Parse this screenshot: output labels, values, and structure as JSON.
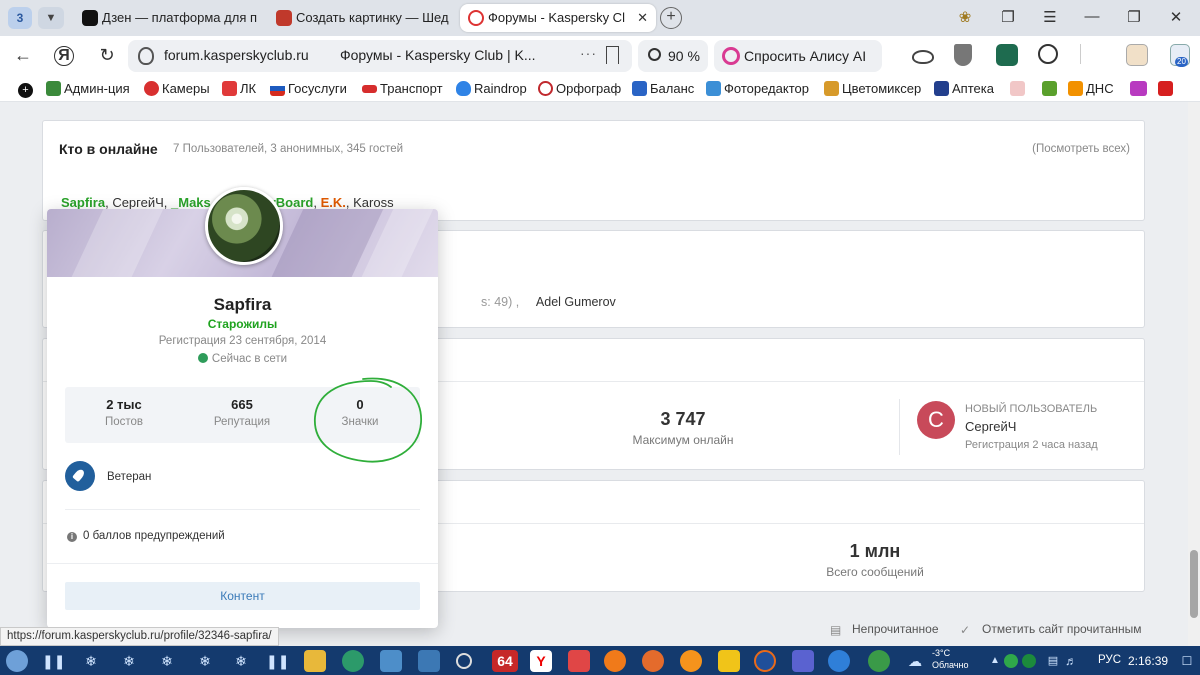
{
  "browser": {
    "tab_counter": "3",
    "tabs": [
      {
        "label": "Дзен — платформа для п",
        "color": "#111111"
      },
      {
        "label": "Создать картинку — Шед",
        "color": "#c0392b"
      },
      {
        "label": "Форумы - Kaspersky Cl",
        "color": "#ffffff"
      }
    ],
    "omnibox": {
      "domain": "forum.kasperskyclub.ru",
      "title": "Форумы - Kaspersky Club | K...",
      "dots": "···"
    },
    "zoom": "90 %",
    "alice": "Спросить Алису AI",
    "ext_badge": "20"
  },
  "bookmarks": [
    {
      "label": "Админ-ция",
      "color": "#3b8a3b"
    },
    {
      "label": "Камеры",
      "color": "#d83030"
    },
    {
      "label": "ЛК",
      "color": "#e03a3a"
    },
    {
      "label": "Госуслуги",
      "color": "#1d5bbf"
    },
    {
      "label": "Транспорт",
      "color": "#d62d2d"
    },
    {
      "label": "Raindrop",
      "color": "#2f83e6"
    },
    {
      "label": "Орфограф",
      "color": "#c0282d"
    },
    {
      "label": "Баланс",
      "color": "#2a64c5"
    },
    {
      "label": "Фоторедактор",
      "color": "#3c8fd6"
    },
    {
      "label": "Цветомиксер",
      "color": "#d79a2a"
    },
    {
      "label": "Аптека",
      "color": "#233f8d"
    },
    {
      "label": "ДНС",
      "color": "#f29100"
    }
  ],
  "online": {
    "title": "Кто в онлайне",
    "meta": "7 Пользователей, 3 анонимных, 345 гостей",
    "view_all": "(Посмотреть всех)",
    "users": {
      "sapfira": "Sapfira",
      "sergey": "СергейЧ",
      "maks": "_Maks__",
      "mother": "MotherBoard",
      "ek": "E.K.",
      "kaross": "Kaross",
      "sep": ", "
    }
  },
  "birthday": {
    "age_suffix": "s: 49) ,",
    "name": "Adel Gumerov"
  },
  "stats": {
    "max_online": {
      "value": "3 747",
      "label": "Максимум онлайн"
    },
    "new_user": {
      "initial": "С",
      "caption": "Новый пользователь",
      "name": "СергейЧ",
      "registered": "Регистрация 2 часа назад"
    },
    "total_posts": {
      "value": "1 млн",
      "label": "Всего сообщений"
    }
  },
  "footer": {
    "unread": "Непрочитанное",
    "mark_read": "Отметить сайт прочитанным"
  },
  "hovercard": {
    "name": "Sapfira",
    "group": "Старожилы",
    "registered": "Регистрация 23 сентября, 2014",
    "status": "Сейчас в сети",
    "stats": [
      {
        "value": "2 тыс",
        "label": "Постов"
      },
      {
        "value": "665",
        "label": "Репутация"
      },
      {
        "value": "0",
        "label": "Значки"
      }
    ],
    "badge": "Ветеран",
    "warnings": "0 баллов предупреждений",
    "content_button": "Контент"
  },
  "status_url": "https://forum.kasperskyclub.ru/profile/32346-sapfira/",
  "taskbar": {
    "app_64": "64",
    "temp": "-3°C",
    "weather": "Облачно",
    "lang": "РУС",
    "time": "2:16:39"
  }
}
